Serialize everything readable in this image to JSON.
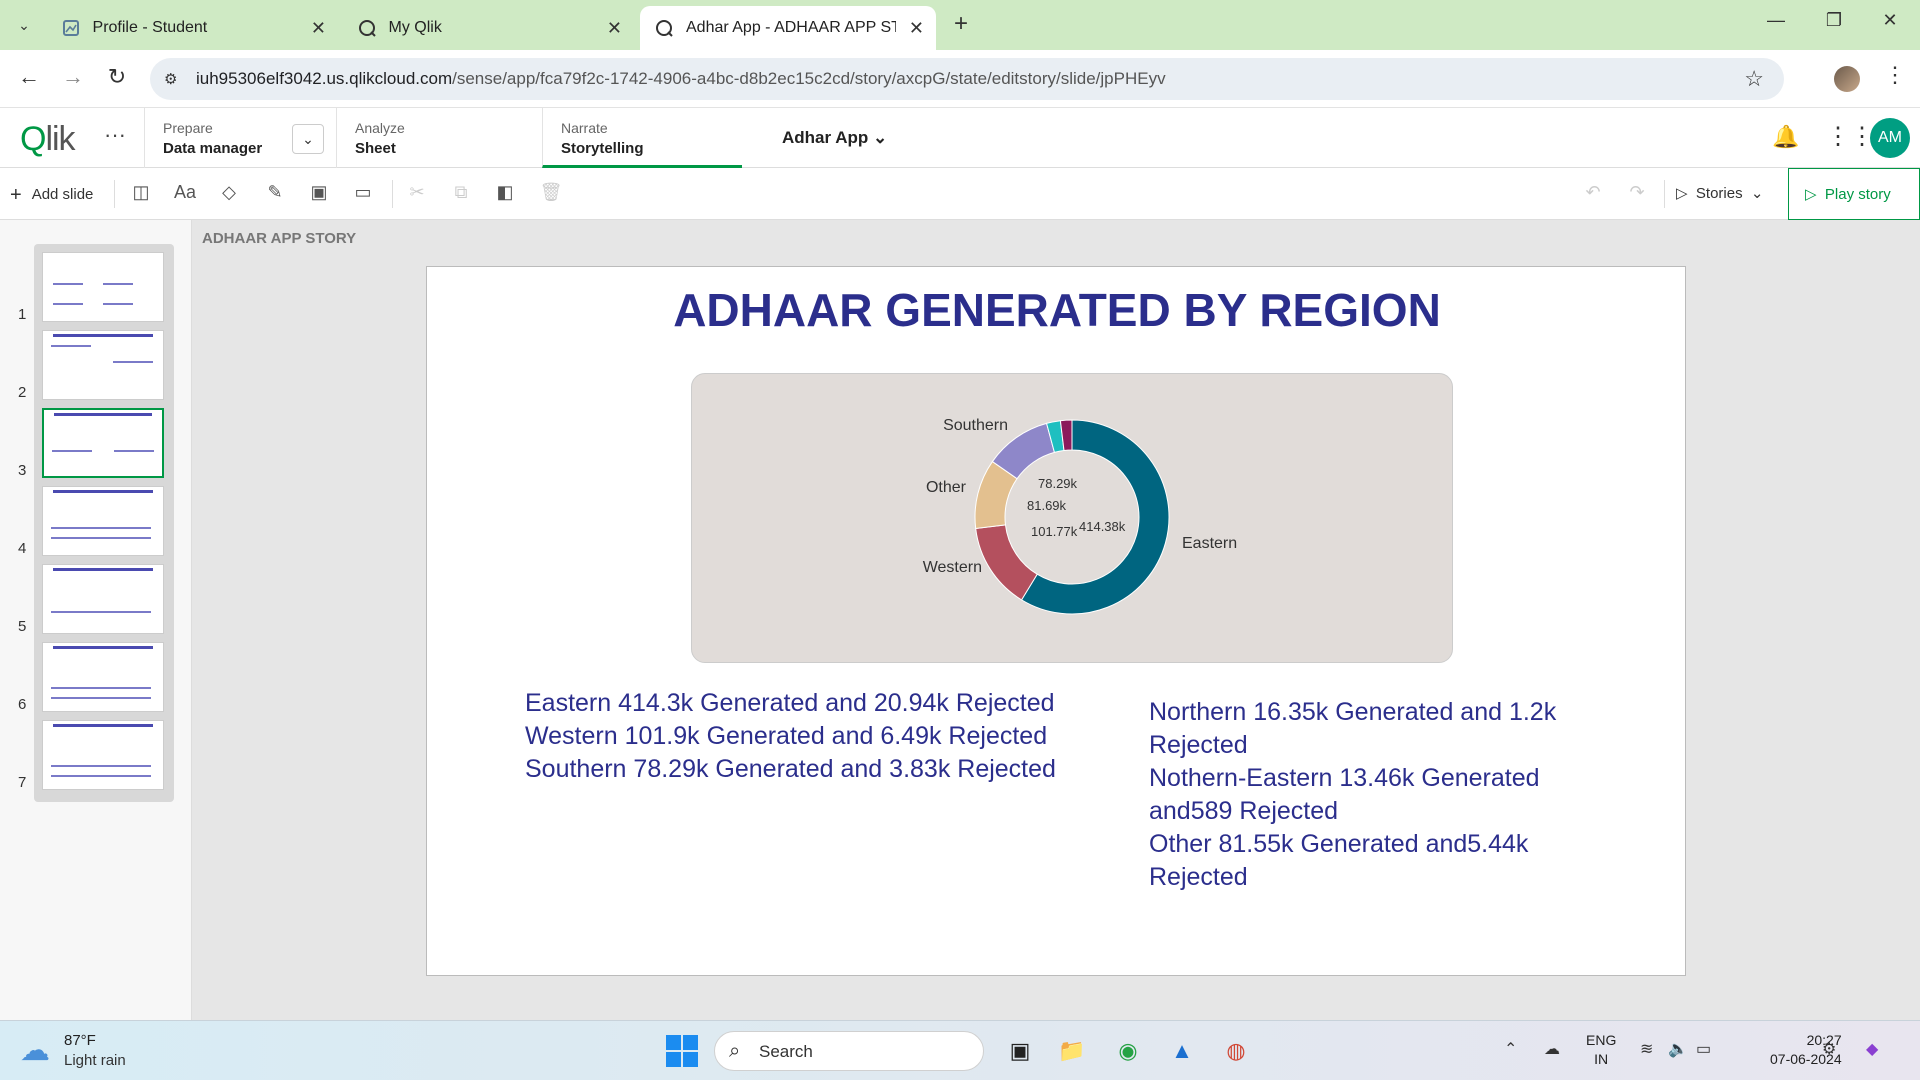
{
  "browser": {
    "tabs": [
      {
        "label": "Profile - Student",
        "icon": "profile-tab-icon"
      },
      {
        "label": "My Qlik",
        "icon": "qlik-tab-icon"
      },
      {
        "label": "Adhar App - ADHAAR APP STO",
        "icon": "qlik-tab-icon"
      }
    ],
    "url_host": "iuh95306elf3042.us.qlikcloud.com",
    "url_path": "/sense/app/fca79f2c-1742-4906-a4bc-d8b2ec15c2cd/story/axcpG/state/editstory/slide/jpPHEyv"
  },
  "qlik": {
    "nav": [
      {
        "small": "Prepare",
        "big": "Data manager"
      },
      {
        "small": "Analyze",
        "big": "Sheet"
      },
      {
        "small": "Narrate",
        "big": "Storytelling"
      }
    ],
    "app_title": "Adhar App",
    "avatar_initials": "AM"
  },
  "toolbar": {
    "add_slide": "Add slide",
    "stories": "Stories",
    "play_story": "Play story"
  },
  "thumbnails": [
    "1",
    "2",
    "3",
    "4",
    "5",
    "6",
    "7"
  ],
  "story": {
    "label": "ADHAAR APP STORY",
    "slide_title": "ADHAAR GENERATED BY REGION",
    "left_text": [
      "Eastern 414.3k Generated and 20.94k Rejected",
      "Western 101.9k Generated and 6.49k Rejected",
      "Southern 78.29k Generated and 3.83k Rejected"
    ],
    "right_text": [
      "Northern 16.35k Generated and 1.2k\nRejected",
      "Nothern-Eastern 13.46k Generated\nand589 Rejected",
      "Other 81.55k Generated and5.44k\nRejected"
    ]
  },
  "chart_data": {
    "type": "pie",
    "donut": true,
    "title": "",
    "series": [
      {
        "name": "Eastern",
        "value": 414.38,
        "label": "414.38k",
        "color": "#006580"
      },
      {
        "name": "Western",
        "value": 101.77,
        "label": "101.77k",
        "color": "#b4505e"
      },
      {
        "name": "Other",
        "value": 81.69,
        "label": "81.69k",
        "color": "#e3c08f"
      },
      {
        "name": "Southern",
        "value": 78.29,
        "label": "78.29k",
        "color": "#8e87c9"
      },
      {
        "name": "",
        "value": 16.35,
        "label": "",
        "color": "#1ebfc0"
      },
      {
        "name": "",
        "value": 13.46,
        "label": "",
        "color": "#8b1a5c"
      }
    ]
  },
  "taskbar": {
    "temp": "87°F",
    "weather": "Light rain",
    "search": "Search",
    "lang1": "ENG",
    "lang2": "IN",
    "time": "20:27",
    "date": "07-06-2024"
  }
}
